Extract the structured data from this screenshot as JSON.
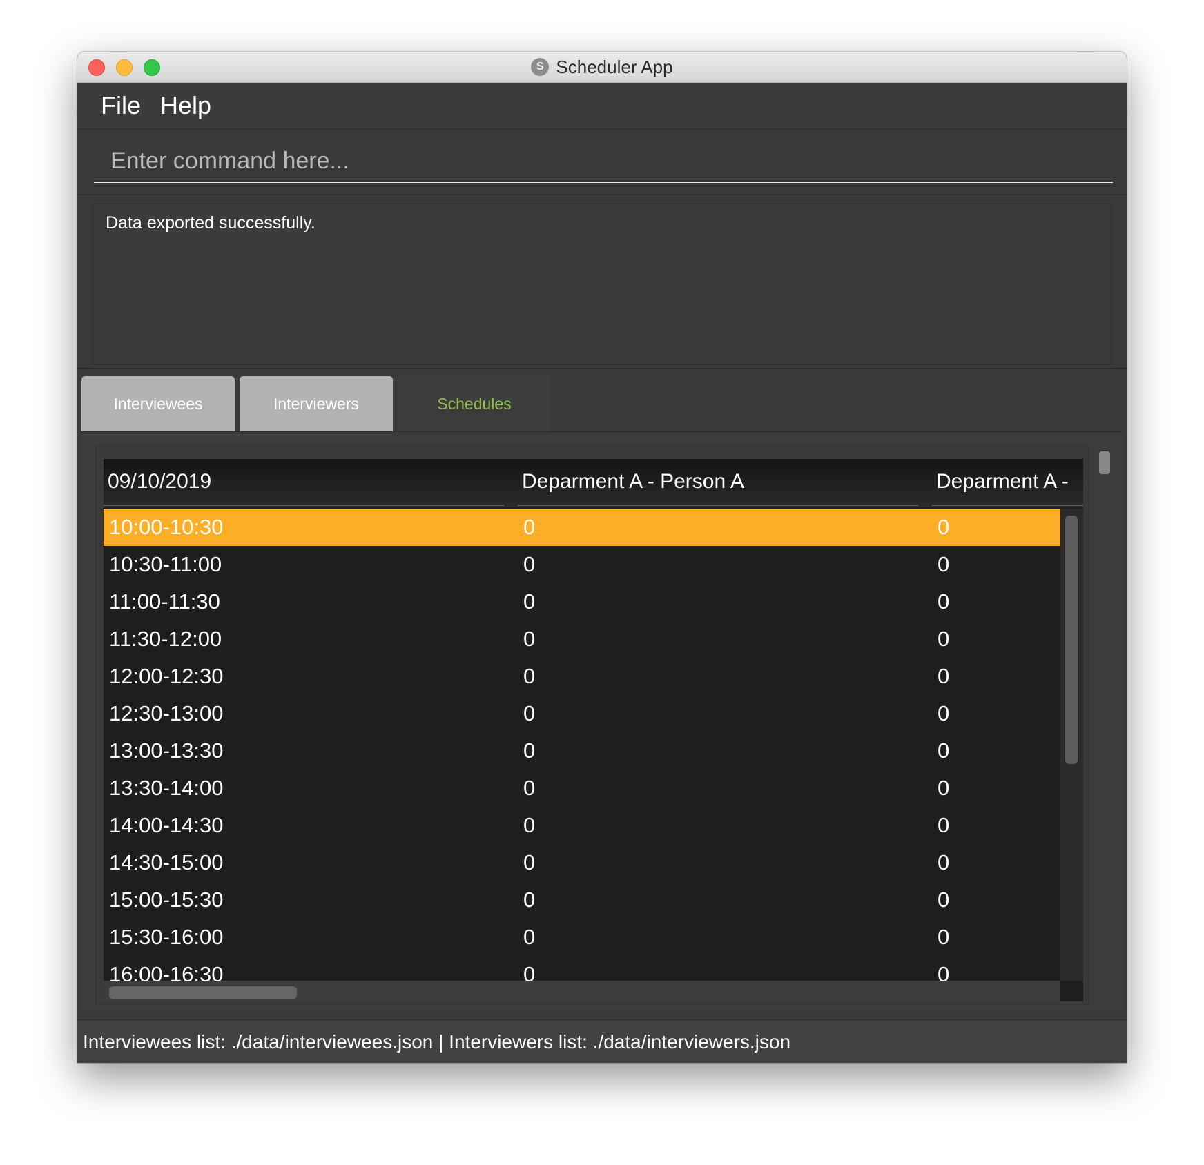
{
  "window": {
    "title": "Scheduler App",
    "app_icon_letter": "S"
  },
  "menu": {
    "file": "File",
    "help": "Help"
  },
  "command": {
    "placeholder": "Enter command here..."
  },
  "result": {
    "message": "Data exported successfully."
  },
  "tabs": [
    {
      "label": "Interviewees",
      "active": false
    },
    {
      "label": "Interviewers",
      "active": false
    },
    {
      "label": "Schedules",
      "active": true
    }
  ],
  "table": {
    "headers": [
      "09/10/2019",
      "Deparment A - Person A",
      "Deparment A -"
    ],
    "rows": [
      [
        "10:00-10:30",
        "0",
        "0"
      ],
      [
        "10:30-11:00",
        "0",
        "0"
      ],
      [
        "11:00-11:30",
        "0",
        "0"
      ],
      [
        "11:30-12:00",
        "0",
        "0"
      ],
      [
        "12:00-12:30",
        "0",
        "0"
      ],
      [
        "12:30-13:00",
        "0",
        "0"
      ],
      [
        "13:00-13:30",
        "0",
        "0"
      ],
      [
        "13:30-14:00",
        "0",
        "0"
      ],
      [
        "14:00-14:30",
        "0",
        "0"
      ],
      [
        "14:30-15:00",
        "0",
        "0"
      ],
      [
        "15:00-15:30",
        "0",
        "0"
      ],
      [
        "15:30-16:00",
        "0",
        "0"
      ],
      [
        "16:00-16:30",
        "0",
        "0"
      ]
    ],
    "selected_row": 0
  },
  "status": {
    "text": "Interviewees list: ./data/interviewees.json | Interviewers list: ./data/interviewers.json"
  },
  "colors": {
    "selection": "#fcaf26",
    "active_tab_text": "#8fbe4a",
    "window_bg": "#3a3a3a",
    "table_bg": "#1e1e1e"
  },
  "icons": {
    "close": "close-icon",
    "minimize": "minimize-icon",
    "maximize": "maximize-icon",
    "app": "app-icon"
  }
}
